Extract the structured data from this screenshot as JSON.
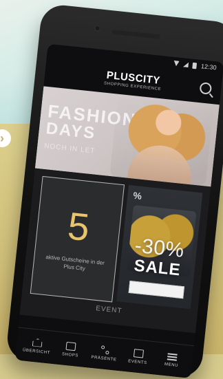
{
  "status_bar": {
    "time": "12:30"
  },
  "app": {
    "brand": "PLUSCITY",
    "tagline": "SHOPPING EXPERIENCE"
  },
  "hero": {
    "line1": "FASHION",
    "line2": "DAYS",
    "line3": "NOCH IN LET"
  },
  "cards": {
    "vouchers": {
      "number": "5",
      "text": "aktive Gutscheine in der Plus City"
    },
    "sale": {
      "top_text": "%",
      "percent": "-30%",
      "word": "SALE"
    }
  },
  "section": {
    "label": "EVENT"
  },
  "bottom_nav": [
    {
      "label": "ÜBERSICHT",
      "icon": "home-icon"
    },
    {
      "label": "SHOPS",
      "icon": "shop-icon"
    },
    {
      "label": "PRÄSENTE",
      "icon": "percent-icon"
    },
    {
      "label": "EVENTS",
      "icon": "event-icon"
    },
    {
      "label": "MENU",
      "icon": "menu-icon"
    }
  ]
}
